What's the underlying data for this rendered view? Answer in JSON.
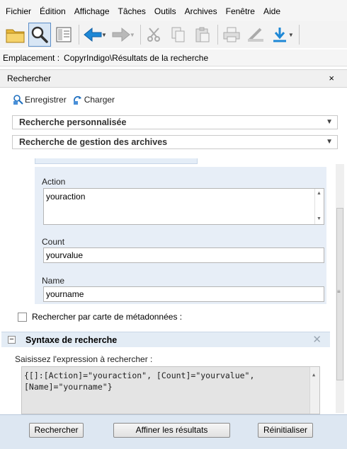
{
  "menu": [
    "Fichier",
    "Édition",
    "Affichage",
    "Tâches",
    "Outils",
    "Archives",
    "Fenêtre",
    "Aide"
  ],
  "location": {
    "label": "Emplacement :",
    "value": "CopyrIndigo\\Résultats de la recherche"
  },
  "panel": {
    "title": "Rechercher",
    "close": "×"
  },
  "saves": {
    "save": "Enregistrer",
    "load": "Charger"
  },
  "sections": {
    "custom": "Recherche personnalisée",
    "records": "Recherche de gestion des archives"
  },
  "fields": {
    "action": {
      "label": "Action",
      "value": "youraction"
    },
    "count": {
      "label": "Count",
      "value": "yourvalue"
    },
    "name": {
      "label": "Name",
      "value": "yourname"
    }
  },
  "metadata_checkbox": "Rechercher par carte de métadonnées :",
  "syntax": {
    "title": "Syntaxe de recherche",
    "prompt": "Saisissez l'expression à rechercher :",
    "line1": "{[]:[Action]=\"youraction\", [Count]=\"yourvalue\",",
    "line2": "[Name]=\"yourname\"}"
  },
  "buttons": {
    "search": "Rechercher",
    "refine": "Affiner les résultats",
    "reset": "Réinitialiser"
  },
  "colors": {
    "accent_blue": "#1e88d6",
    "panel_blue": "#e7eef7",
    "bottom_blue": "#dde7f2"
  }
}
